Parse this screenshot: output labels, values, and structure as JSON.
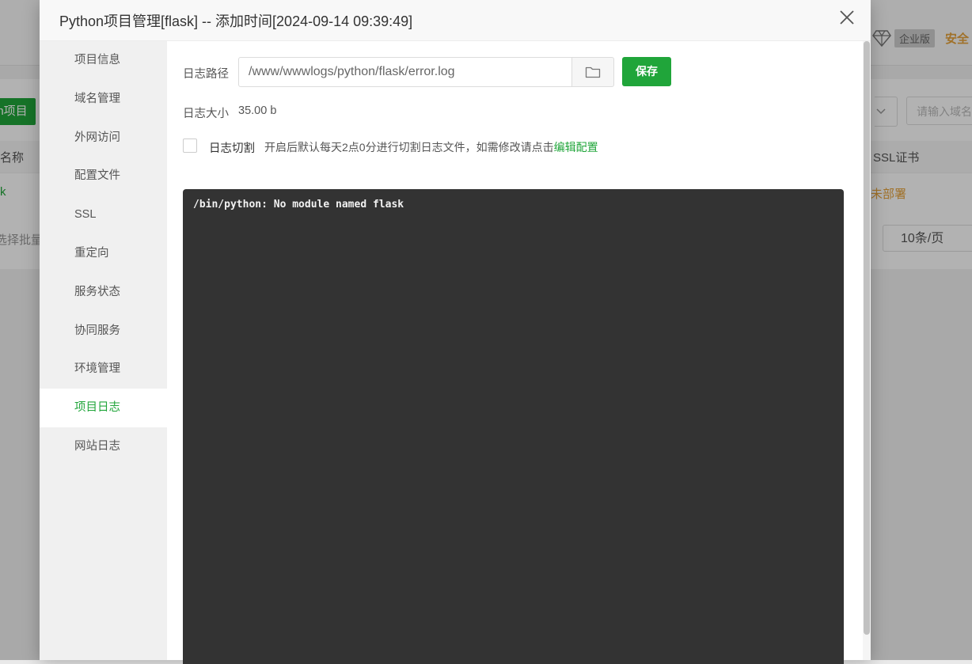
{
  "background": {
    "enterprise_badge": "企业版",
    "safe_label": "安全",
    "add_project_button": "on项目",
    "col_name": "名称",
    "row_name_fragment": "k",
    "ssl_col": "SSL证书",
    "deploy_link": "未部署",
    "batch_select": "选择批量",
    "search_placeholder": "请输入域名",
    "page_size": "10条/页"
  },
  "modal": {
    "title": "Python项目管理[flask] -- 添加时间[2024-09-14 09:39:49]",
    "sidebar": {
      "items": [
        {
          "label": "项目信息",
          "active": false
        },
        {
          "label": "域名管理",
          "active": false
        },
        {
          "label": "外网访问",
          "active": false
        },
        {
          "label": "配置文件",
          "active": false
        },
        {
          "label": "SSL",
          "active": false
        },
        {
          "label": "重定向",
          "active": false
        },
        {
          "label": "服务状态",
          "active": false
        },
        {
          "label": "协同服务",
          "active": false
        },
        {
          "label": "环境管理",
          "active": false
        },
        {
          "label": "项目日志",
          "active": true
        },
        {
          "label": "网站日志",
          "active": false
        }
      ]
    },
    "log": {
      "path_label": "日志路径",
      "path_value": "/www/wwwlogs/python/flask/error.log",
      "save_label": "保存",
      "size_label": "日志大小",
      "size_value": "35.00 b",
      "cut_label": "日志切割",
      "cut_desc": "开启后默认每天2点0分进行切割日志文件，如需修改请点击",
      "edit_link": "编辑配置",
      "content": "/bin/python: No module named flask"
    },
    "colors": {
      "accent": "#20a53a",
      "log_bg": "#333333",
      "sidebar_bg": "#f0f0f0"
    }
  }
}
